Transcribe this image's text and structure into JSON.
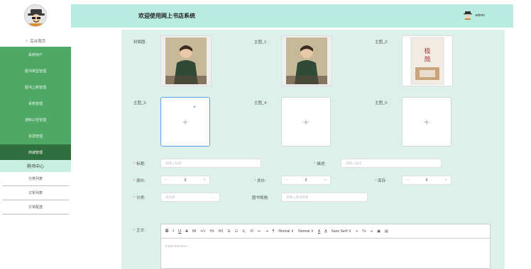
{
  "header": {
    "title": "欢迎使用网上书店系统",
    "user": "admin"
  },
  "sidebar": {
    "home": "后台首页",
    "menu": [
      "系统用户",
      "图书类型管理",
      "图书上新管理",
      "系统管理",
      "通知公告管理",
      "资源管理"
    ],
    "active": "商城管理",
    "submenu_head": "购书中心",
    "submenu": [
      "分类列表",
      "订单列表",
      "订单配送"
    ]
  },
  "form": {
    "cover_label": "封面图:",
    "main1_label": "主图_1:",
    "main2_label": "主图_2:",
    "main3_label": "主图_3:",
    "main4_label": "主图_4:",
    "main5_label": "主图_5:",
    "title_label": "标题:",
    "title_placeholder": "请输入标题",
    "desc_label": "描述:",
    "desc_placeholder": "请输入描述",
    "orig_price_label": "原价:",
    "orig_price_value": "0",
    "price_label": "卖价:",
    "price_value": "0",
    "stock_label": "库存:",
    "stock_value": "0",
    "category_label": "分类:",
    "category_placeholder": "请选择",
    "spec_label": "图书规格:",
    "spec_placeholder": "请输入图书规格",
    "body_label": "正文:",
    "editor_placeholder": "Insert text here ...",
    "toolbar": {
      "bold": "B",
      "italic": "I",
      "underline": "U",
      "strike": "S",
      "quote": "99",
      "code": "</>",
      "h1": "H1",
      "h2": "H2",
      "ol": "☰",
      "ul": "☷",
      "sub": "X₁",
      "sup": "X²",
      "indent_out": "⇤",
      "indent_in": "⇥",
      "rtl": "¶",
      "size": "Normal",
      "header": "Normal",
      "color": "A",
      "bg": "A̲",
      "font": "Sans Serif",
      "align": "≡",
      "clean": "Tx",
      "link": "🔗",
      "image": "🖼",
      "video": "▤"
    }
  },
  "colors": {
    "menu": "#4ea866",
    "menu_active": "#2f6e3d",
    "header": "#b8ece0",
    "content": "#dcf1ea"
  }
}
